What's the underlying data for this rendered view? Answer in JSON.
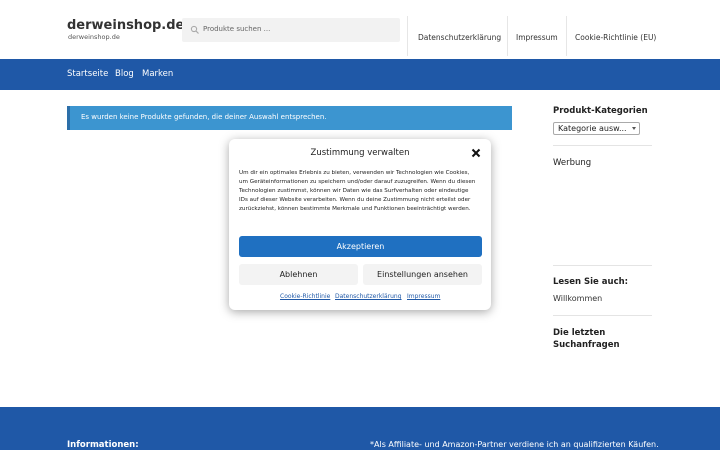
{
  "header": {
    "site_title": "derweinshop.de",
    "site_description": "derweinshop.de",
    "search_placeholder": "Produkte suchen ...",
    "top_nav": [
      "Datenschutzerklärung",
      "Impressum",
      "Cookie-Richtlinie (EU)"
    ]
  },
  "main_nav": [
    "Startseite",
    "Blog",
    "Marken"
  ],
  "notice": {
    "text": "Es wurden keine Produkte gefunden, die deiner Auswahl entsprechen."
  },
  "sidebar": {
    "categories_title": "Produkt-Kategorien",
    "categories_select_value": "Kategorie ausw...",
    "ad_title": "Werbung",
    "read_also_title": "Lesen Sie auch:",
    "read_also_link": "Willkommen",
    "recent_searches_title_1": "Die letzten",
    "recent_searches_title_2": "Suchanfragen"
  },
  "footer": {
    "info_title": "Informationen:",
    "affiliate_text": "*Als Affiliate- und Amazon-Partner verdiene ich an qualifizierten Käufen."
  },
  "cookie_modal": {
    "title": "Zustimmung verwalten",
    "body": "Um dir ein optimales Erlebnis zu bieten, verwenden wir Technologien wie Cookies, um Geräteinformationen zu speichern und/oder darauf zuzugreifen. Wenn du diesen Technologien zustimmst, können wir Daten wie das Surfverhalten oder eindeutige IDs auf dieser Website verarbeiten. Wenn du deine Zustimmung nicht erteilst oder zurückziehst, können bestimmte Merkmale und Funktionen beeinträchtigt werden.",
    "accept_label": "Akzeptieren",
    "deny_label": "Ablehnen",
    "settings_label": "Einstellungen ansehen",
    "links": [
      "Cookie-Richtlinie",
      "Datenschutzerklärung",
      "Impressum"
    ]
  },
  "colors": {
    "brand_blue": "#1f58a7",
    "notice_blue": "#3c95d0",
    "accept_blue": "#1f70c1"
  },
  "icons": {
    "search": "search-icon",
    "close": "close-icon",
    "select_arrow": "chevron-down-icon"
  }
}
